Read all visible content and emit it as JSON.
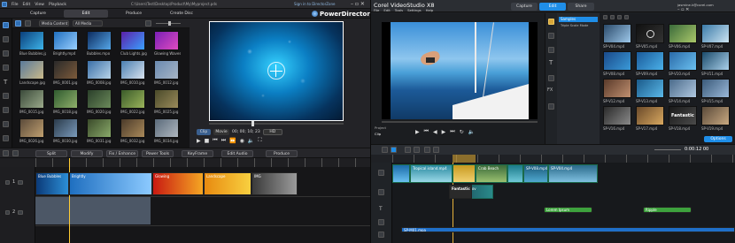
{
  "powerdirector": {
    "menu": [
      "File",
      "Edit",
      "View",
      "Playback"
    ],
    "title_path": "C:\\Users\\Test\\Desktop\\Product\\My\\Myproject.pds",
    "signin": "Sign in to DirectorZone",
    "tabs": [
      "Capture",
      "Edit",
      "Produce",
      "Create Disc"
    ],
    "active_tab": "Edit",
    "brand": "PowerDirector",
    "filters": [
      "Media Content",
      "All Media"
    ],
    "media": [
      {
        "name": "Blue Bubbles.jpg",
        "c1": "#0a3e7a",
        "c2": "#3db3e8"
      },
      {
        "name": "Brightly.mp4",
        "c1": "#1f6fc0",
        "c2": "#9ad0ff"
      },
      {
        "name": "Bubbles.mpo",
        "c1": "#0c2b5e",
        "c2": "#55a6e8"
      },
      {
        "name": "Club Lights.jpg",
        "c1": "#5b1fa8",
        "c2": "#3aa0ff"
      },
      {
        "name": "Glowing Waves.jpg",
        "c1": "#7a1fb5",
        "c2": "#e04cc0"
      },
      {
        "name": "Landscape.jpg",
        "c1": "#5a7a9a",
        "c2": "#c9b98a"
      },
      {
        "name": "IMG_0001.jpg",
        "c1": "#2a2a2a",
        "c2": "#7c5a3a"
      },
      {
        "name": "IMG_0008.jpg",
        "c1": "#3a6fa8",
        "c2": "#b8d4e8"
      },
      {
        "name": "IMG_0010.jpg",
        "c1": "#4a7fb0",
        "c2": "#d8e2ee"
      },
      {
        "name": "IMG_0012.jpg",
        "c1": "#6a8ab0",
        "c2": "#a7b5c5"
      },
      {
        "name": "IMG_0015.jpg",
        "c1": "#3a4a3a",
        "c2": "#9aa98a"
      },
      {
        "name": "IMG_0018.jpg",
        "c1": "#2f5a2f",
        "c2": "#8fb06a"
      },
      {
        "name": "IMG_0020.jpg",
        "c1": "#2a3f2a",
        "c2": "#6b8a5a"
      },
      {
        "name": "IMG_0022.jpg",
        "c1": "#3a5a2a",
        "c2": "#9ab45a"
      },
      {
        "name": "IMG_0025.jpg",
        "c1": "#4a4a2a",
        "c2": "#9a8a5a"
      },
      {
        "name": "IMG_0026.jpg",
        "c1": "#5a4a3a",
        "c2": "#c0a070"
      },
      {
        "name": "IMG_0030.jpg",
        "c1": "#2a3a4a",
        "c2": "#7a9aba"
      },
      {
        "name": "IMG_0031.jpg",
        "c1": "#3a4a2a",
        "c2": "#8aaa6a"
      },
      {
        "name": "IMG_0032.jpg",
        "c1": "#4a3a2a",
        "c2": "#aa8a5a"
      },
      {
        "name": "IMG_0034.jpg",
        "c1": "#5a6a7a",
        "c2": "#b0b8c0"
      }
    ],
    "clip_mode": "Clip",
    "movie_mode": "Movie",
    "timecode": "00; 00; 10; 23",
    "quality": "HD",
    "edit_buttons": [
      "Split",
      "Modify",
      "Fix / Enhance",
      "Power Tools",
      "KeyFrame",
      "Edit Audio",
      "Produce"
    ],
    "timeline_clips": [
      {
        "name": "Blue Bubbles",
        "c1": "#0b3a78",
        "c2": "#2c8ed6"
      },
      {
        "name": "Brightly",
        "c1": "#1f6fc0",
        "c2": "#8ccaff"
      },
      {
        "name": "Glowing",
        "c1": "#c81a12",
        "c2": "#f5a623"
      },
      {
        "name": "Landscape",
        "c1": "#e88a10",
        "c2": "#f8d040"
      },
      {
        "name": "IMG",
        "c1": "#3a3a3a",
        "c2": "#9a9a9a"
      }
    ],
    "track_ids": [
      "1",
      "2"
    ]
  },
  "videostudio": {
    "brand": "Corel VideoStudio X8",
    "menu": [
      "File",
      "Edit",
      "Tools",
      "Settings",
      "Help"
    ],
    "tabs": [
      "Capture",
      "Edit",
      "Share"
    ],
    "active_tab": "Edit",
    "user": "jasmine.k@corel.com",
    "library_folder": "Samples",
    "library_sub": "Triple Scale Mode",
    "project_label": "Project",
    "clip_label": "Clip",
    "library_items": [
      {
        "name": "SP-V04.mp4",
        "c1": "#2a4a6a",
        "c2": "#9ec8ea",
        "kind": "video"
      },
      {
        "name": "SP-V05.mp4",
        "c1": "#111",
        "c2": "#333",
        "kind": "icon"
      },
      {
        "name": "SP-V06.mp4",
        "c1": "#3a6a3a",
        "c2": "#aac86a",
        "kind": "video"
      },
      {
        "name": "SP-V07.mp4",
        "c1": "#3a7aa8",
        "c2": "#cce4f2",
        "kind": "video"
      },
      {
        "name": "SP-V08.mp4",
        "c1": "#1a4a8a",
        "c2": "#3a9ad8",
        "kind": "video"
      },
      {
        "name": "SP-V09.mp4",
        "c1": "#1a5a9a",
        "c2": "#4ab0e8",
        "kind": "video"
      },
      {
        "name": "SP-V10.mp4",
        "c1": "#2a6aa8",
        "c2": "#6ac0f0",
        "kind": "video"
      },
      {
        "name": "SP-V11.mp4",
        "c1": "#1a4a6a",
        "c2": "#aad0ea",
        "kind": "video"
      },
      {
        "name": "SP-V12.mp4",
        "c1": "#5a3a2a",
        "c2": "#c09070",
        "kind": "video"
      },
      {
        "name": "SP-V13.mp4",
        "c1": "#1a5a8a",
        "c2": "#5ab8e8",
        "kind": "video"
      },
      {
        "name": "SP-V14.mp4",
        "c1": "#4a6a8a",
        "c2": "#b0c8e0",
        "kind": "video"
      },
      {
        "name": "SP-V15.mp4",
        "c1": "#3a5a7a",
        "c2": "#9ab8d8",
        "kind": "video"
      },
      {
        "name": "SP-V16.mp4",
        "c1": "#2a2a2a",
        "c2": "#8a8a8a",
        "kind": "video"
      },
      {
        "name": "SP-V17.mp4",
        "c1": "#6a4a2a",
        "c2": "#d8a860",
        "kind": "video"
      },
      {
        "name": "SP-V18.mp4",
        "c1": "#1a1a1a",
        "c2": "#4a4a4a",
        "kind": "title"
      },
      {
        "name": "SP-V19.mp4",
        "c1": "#5a4a3a",
        "c2": "#c8a880",
        "kind": "video"
      }
    ],
    "title_thumb_text": "Fantastic",
    "options_label": "Options",
    "zoom_time": "0:00:12 00",
    "timeline_clips": [
      {
        "name": "",
        "c1": "#1a6aa8",
        "c2": "#6ac0f0"
      },
      {
        "name": "Tropical island.mp4",
        "c1": "#2a8aa0",
        "c2": "#9ad8e8"
      },
      {
        "name": "",
        "c1": "#c89a20",
        "c2": "#f0d070"
      },
      {
        "name": "Crab Beach",
        "c1": "#3a6a3a",
        "c2": "#9ac070"
      },
      {
        "name": "",
        "c1": "#1a7a8a",
        "c2": "#70c8d8"
      },
      {
        "name": "SP-V08.mp4",
        "c1": "#1a5a7a",
        "c2": "#50a8d0"
      },
      {
        "name": "SP-V04.mp4",
        "c1": "#2a6a8a",
        "c2": "#80c0e0"
      }
    ],
    "overlay_clip": "sp-V03.mov",
    "title_clip": "Fantastic",
    "title_overlay_text": "SP-V08.mp4",
    "text_clips": [
      "Lorem Ipsum",
      "Ripple"
    ],
    "music_clip": "SP-M01.mpa"
  }
}
